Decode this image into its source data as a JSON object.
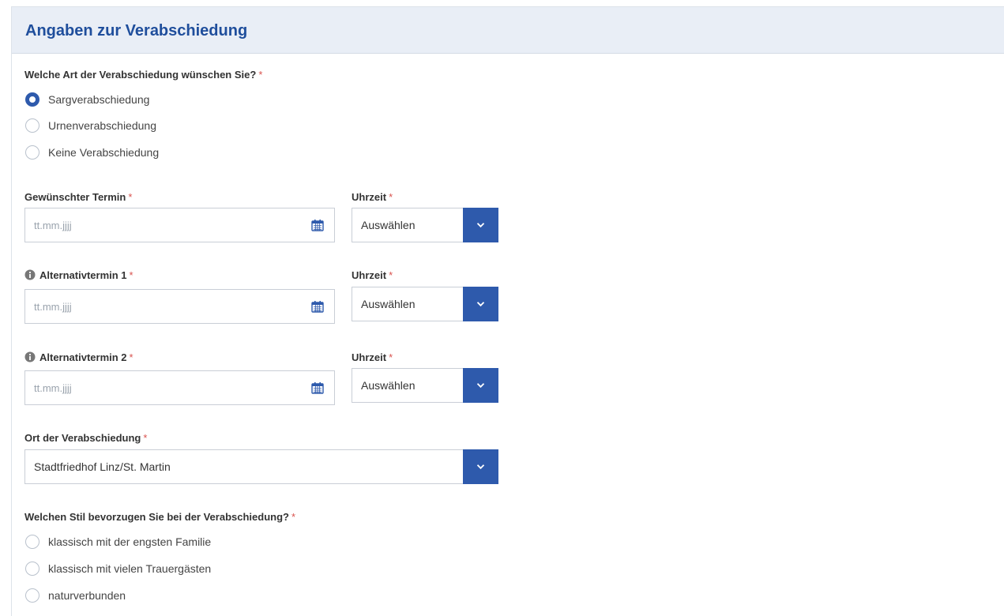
{
  "section": {
    "title": "Angaben zur Verabschiedung"
  },
  "required_mark": "*",
  "farewell_type": {
    "question": "Welche Art der Verabschiedung wünschen Sie?",
    "options": [
      "Sargverabschiedung",
      "Urnenverabschiedung",
      "Keine Verabschiedung"
    ],
    "selected": "Sargverabschiedung"
  },
  "dates": [
    {
      "label": "Gewünschter Termin",
      "info": false,
      "placeholder": "tt.mm.jjjj",
      "time_label": "Uhrzeit",
      "time_value": "Auswählen"
    },
    {
      "label": "Alternativtermin 1",
      "info": true,
      "placeholder": "tt.mm.jjjj",
      "time_label": "Uhrzeit",
      "time_value": "Auswählen"
    },
    {
      "label": "Alternativtermin 2",
      "info": true,
      "placeholder": "tt.mm.jjjj",
      "time_label": "Uhrzeit",
      "time_value": "Auswählen"
    }
  ],
  "location": {
    "label": "Ort der Verabschiedung",
    "value": "Stadtfriedhof Linz/St. Martin"
  },
  "style": {
    "question": "Welchen Stil bevorzugen Sie bei der Verabschiedung?",
    "options": [
      "klassisch mit der engsten Familie",
      "klassisch mit vielen Trauergästen",
      "naturverbunden"
    ]
  },
  "colors": {
    "accent": "#2e5aac",
    "title": "#1f4e9c",
    "header_bg": "#e9eef6",
    "required": "#d9534f"
  },
  "icons": {
    "date": "calendar-icon",
    "dropdown": "chevron-down-icon",
    "info": "info-circle-icon"
  }
}
